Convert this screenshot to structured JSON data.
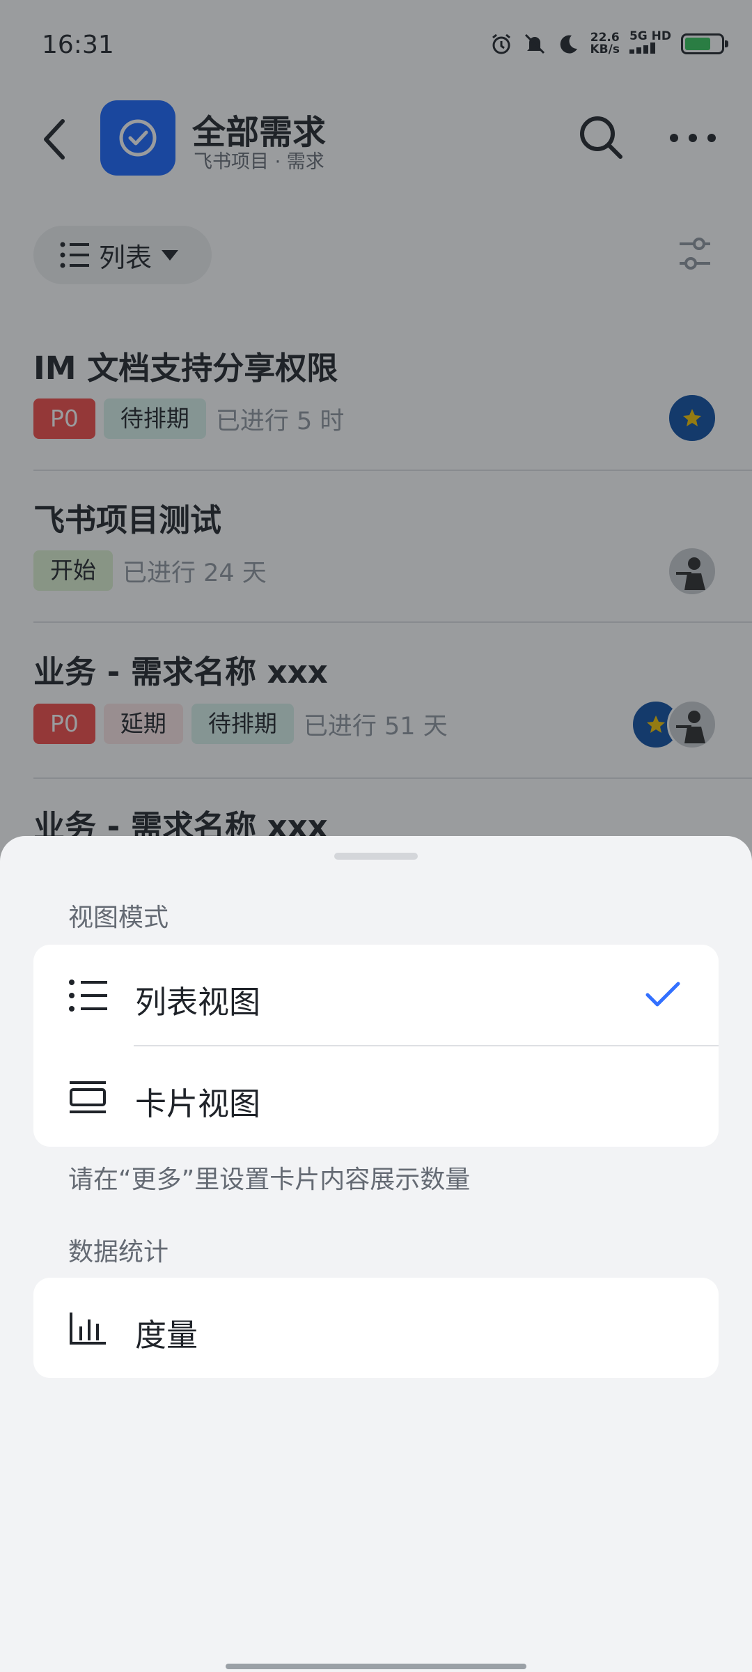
{
  "status_bar": {
    "time": "16:31",
    "net_speed": "22.6",
    "net_unit": "KB/s",
    "net_type": "5G HD"
  },
  "header": {
    "title": "全部需求",
    "subtitle": "飞书项目 · 需求"
  },
  "toolbar": {
    "view_label": "列表"
  },
  "items": [
    {
      "title": "IM 文档支持分享权限",
      "tags": [
        "P0",
        "待排期"
      ],
      "duration": "已进行 5 时"
    },
    {
      "title": "飞书项目测试",
      "tags": [
        "开始"
      ],
      "duration": "已进行 24 天"
    },
    {
      "title": "业务 - 需求名称 xxx",
      "tags": [
        "P0",
        "延期",
        "待排期"
      ],
      "duration": "已进行 51 天"
    },
    {
      "title": "业务 - 需求名称 xxx"
    }
  ],
  "sheet": {
    "view_mode_label": "视图模式",
    "options": [
      {
        "label": "列表视图",
        "selected": true
      },
      {
        "label": "卡片视图",
        "selected": false
      }
    ],
    "hint": "请在“更多”里设置卡片内容展示数量",
    "stats_label": "数据统计",
    "stats_options": [
      {
        "label": "度量"
      }
    ]
  },
  "colors": {
    "brand": "#1664ff",
    "check": "#3370ff",
    "p0": "#f54a45"
  }
}
